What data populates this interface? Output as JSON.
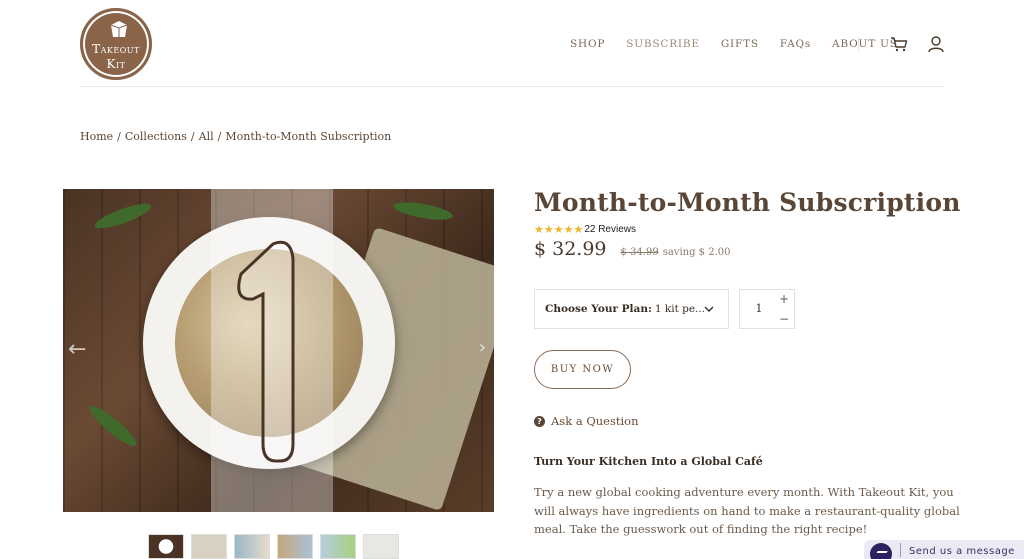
{
  "brand": {
    "logo_line1": "Takeout",
    "logo_line2": "Kit"
  },
  "nav": {
    "items": [
      {
        "label": "SHOP"
      },
      {
        "label": "SUBSCRIBE",
        "active": true
      },
      {
        "label": "GIFTS"
      },
      {
        "label": "FAQs"
      },
      {
        "label": "ABOUT US"
      }
    ],
    "icons": [
      "cart-icon",
      "user-icon"
    ]
  },
  "breadcrumb": [
    "Home",
    "/",
    "Collections",
    "/",
    "All",
    "/",
    "Month-to-Month Subscription"
  ],
  "product": {
    "title": "Month-to-Month Subscription",
    "stars": "★★★★★",
    "rating": 5,
    "reviews": "22 Reviews",
    "price": "$ 32.99",
    "compare_price": "$ 34.99",
    "saving": "saving $ 2.00",
    "plan_label": "Choose Your Plan:",
    "plan_value": "1 kit pe...",
    "quantity": "1",
    "buy_now": "BUY NOW",
    "ask_question": "Ask a Question",
    "thumbnail_count": 6,
    "description_heading": "Turn Your Kitchen Into a Global Café",
    "description": "Try a new global cooking adventure every month. With Takeout Kit, you will always have ingredients on hand to make a restaurant-quality global meal. Take the guesswork out of finding the right recipe!"
  },
  "messenger": {
    "label": "Send us a message"
  },
  "colors": {
    "brand": "#8a6349",
    "text": "#5a4636",
    "star": "#f0b429",
    "messenger_bg": "#ece9f5"
  }
}
